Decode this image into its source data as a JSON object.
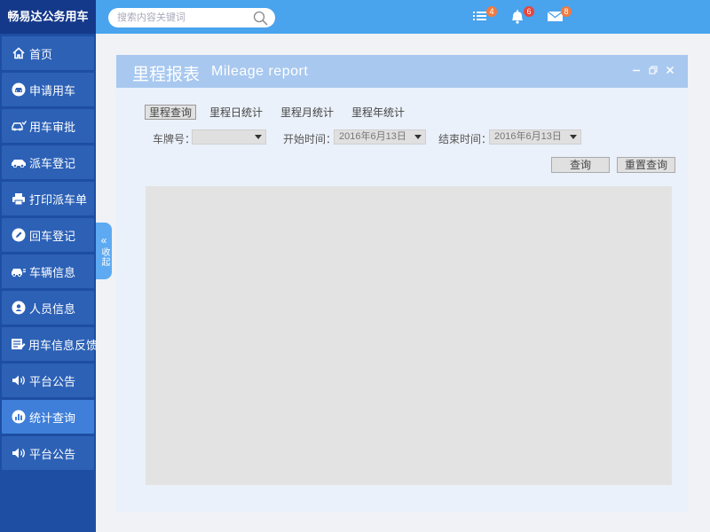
{
  "brand": "畅易达公务用车",
  "search": {
    "placeholder": "搜索内容关键词"
  },
  "notifications": {
    "list_count": "4",
    "bell_count": "6",
    "mail_count": "8",
    "list_badge_color": "#f07b3f",
    "bell_badge_color": "#e8453c",
    "mail_badge_color": "#f07b3f"
  },
  "sidebar": {
    "items": [
      {
        "label": "首页",
        "icon": "home-icon"
      },
      {
        "label": "申请用车",
        "icon": "car-front-icon"
      },
      {
        "label": "用车审批",
        "icon": "car-approve-icon"
      },
      {
        "label": "派车登记",
        "icon": "car-dispatch-icon"
      },
      {
        "label": "打印派车单",
        "icon": "printer-icon"
      },
      {
        "label": "回车登记",
        "icon": "pencil-icon"
      },
      {
        "label": "车辆信息",
        "icon": "car-info-icon"
      },
      {
        "label": "人员信息",
        "icon": "user-icon"
      },
      {
        "label": "用车信息反馈",
        "icon": "feedback-icon"
      },
      {
        "label": "平台公告",
        "icon": "speaker-icon"
      },
      {
        "label": "统计查询",
        "icon": "bar-chart-icon"
      },
      {
        "label": "平台公告",
        "icon": "speaker-icon"
      }
    ],
    "active_index": 10,
    "collapse_label": "收起"
  },
  "panel": {
    "title": "里程报表",
    "subtitle": "Mileage report",
    "tabs": [
      "里程查询",
      "里程日统计",
      "里程月统计",
      "里程年统计"
    ],
    "active_tab": 0,
    "filters": {
      "plate_label": "车牌号：",
      "plate_value": "",
      "start_label": "开始时间：",
      "start_value": "2016年6月13日",
      "end_label": "结束时间：",
      "end_value": "2016年6月13日"
    },
    "buttons": {
      "query": "查询",
      "reset": "重置查询"
    }
  },
  "colors": {
    "sidebar": "#1d4ea3",
    "topbar": "#4aa3ed",
    "panel_header": "#a8c8ef"
  }
}
